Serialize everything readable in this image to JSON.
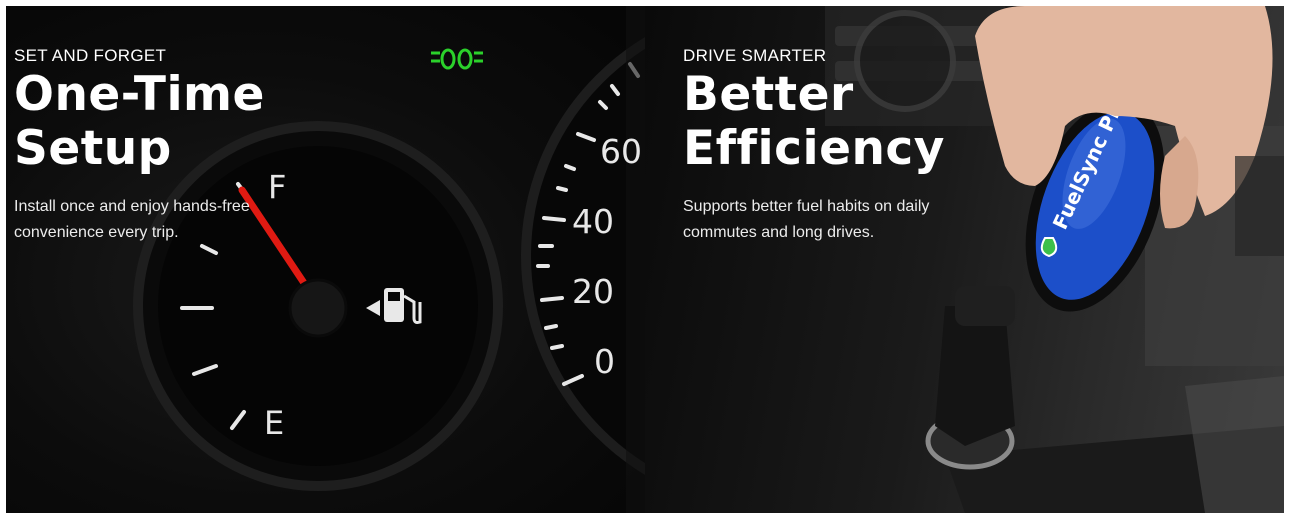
{
  "panels": [
    {
      "eyebrow": "SET AND FORGET",
      "title_line1": "One-Time",
      "title_line2": "Setup",
      "description": "Install once and enjoy hands-free convenience every trip."
    },
    {
      "eyebrow": "DRIVE SMARTER",
      "title_line1": "Better",
      "title_line2": "Efficiency",
      "description": "Supports better fuel habits on daily commutes and long drives."
    }
  ],
  "gauge": {
    "fuel_full_label": "F",
    "fuel_empty_label": "E",
    "speed_ticks": [
      "60",
      "40",
      "20",
      "0"
    ],
    "indicator_icon": "headlight-indicator-icon",
    "fuel_icon": "fuel-pump-icon"
  },
  "device": {
    "brand_text": "FuelSync PRO",
    "brand_icon": "leaf-drop-icon"
  },
  "colors": {
    "needle": "#e01a12",
    "indicator": "#2bd12b",
    "device_blue": "#1c4fc9"
  }
}
